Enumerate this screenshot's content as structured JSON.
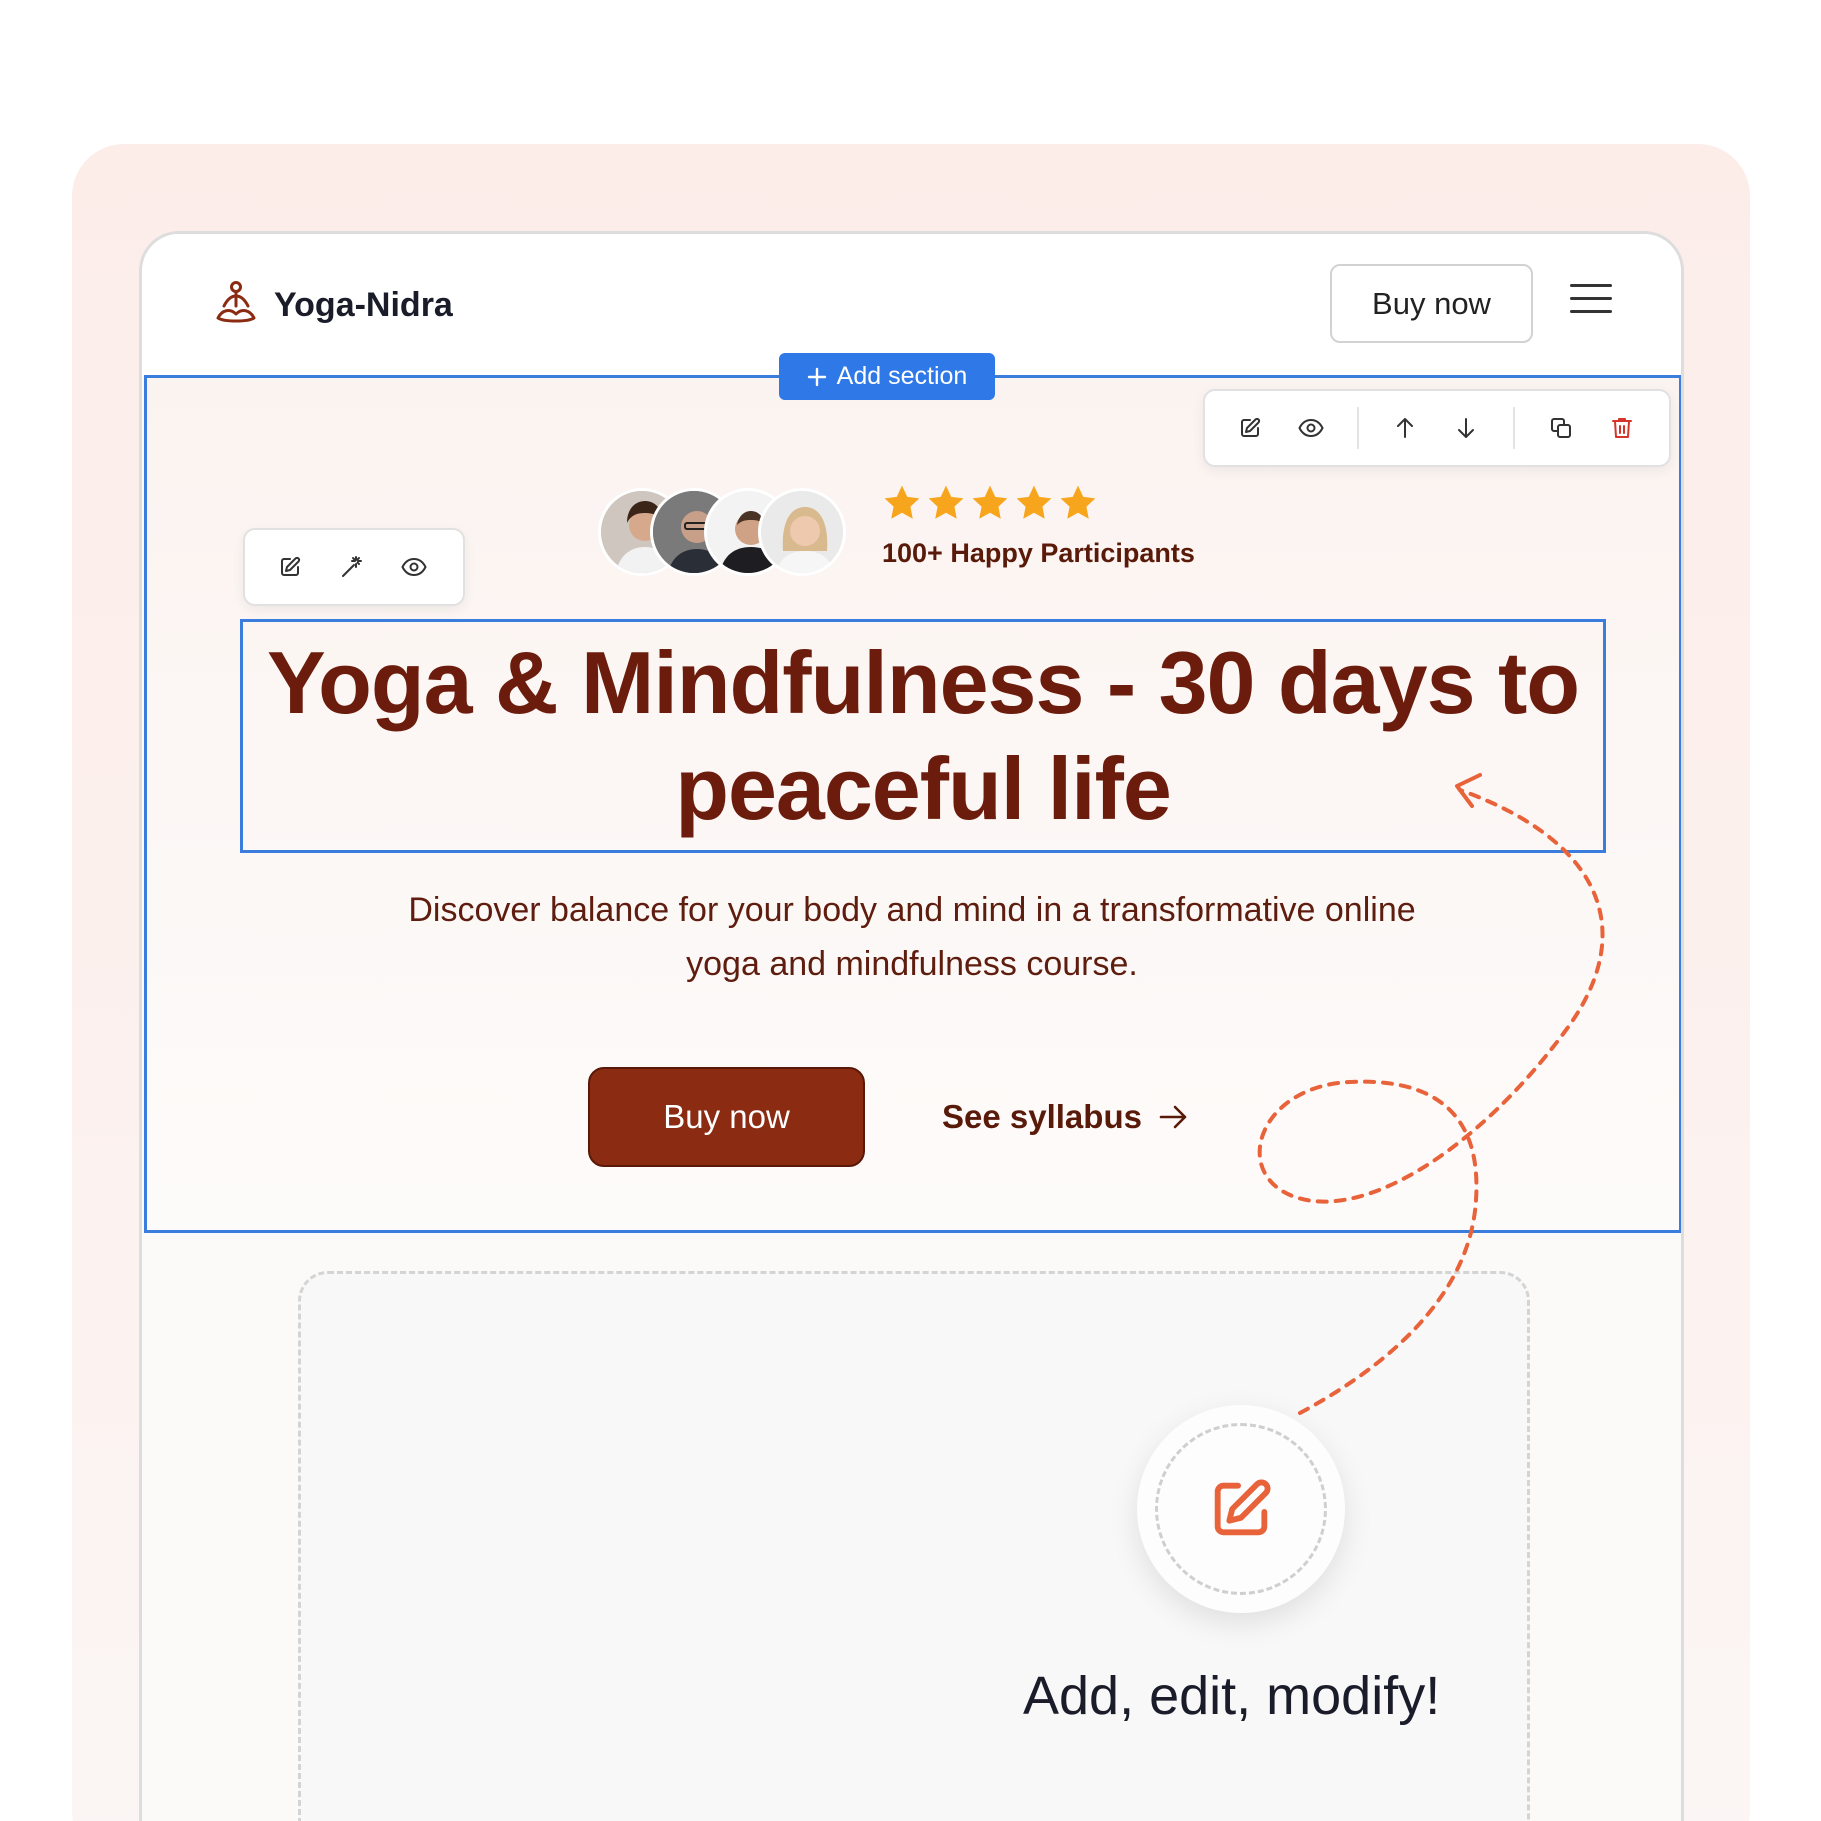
{
  "brand": {
    "name": "Yoga-Nidra",
    "icon": "meditation-person-icon"
  },
  "nav": {
    "buy_label": "Buy now",
    "menu_icon": "hamburger-menu-icon"
  },
  "editor": {
    "add_section_label": "Add section",
    "section_toolbar": [
      "edit-icon",
      "eye-icon",
      "arrow-up-icon",
      "arrow-down-icon",
      "duplicate-icon",
      "trash-icon"
    ],
    "heading_toolbar": [
      "edit-icon",
      "magic-wand-icon",
      "eye-icon"
    ],
    "accent_color": "#2f78e8",
    "delete_color": "#d6332a"
  },
  "hero": {
    "rating_stars": 5,
    "participants": "100+ Happy Participants",
    "heading": "Yoga & Mindfulness - 30 days to peaceful life",
    "subtext": "Discover balance for your body and mind in a transformative online yoga and mindfulness course.",
    "buy_label": "Buy now",
    "syllabus_label": "See syllabus",
    "brand_color": "#8a2b12",
    "text_color": "#6b1c0c",
    "star_color": "#f7a51c"
  },
  "promo": {
    "tagline": "Add, edit, modify!",
    "icon": "edit-icon",
    "accent": "#e8623a"
  }
}
